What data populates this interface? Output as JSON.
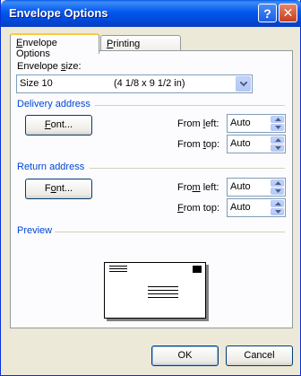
{
  "window": {
    "title": "Envelope Options",
    "help_glyph": "?",
    "close_glyph": "✕"
  },
  "tabs": [
    {
      "label_pre": "",
      "label_key": "E",
      "label_post": "nvelope Options",
      "active": true
    },
    {
      "label_pre": "",
      "label_key": "P",
      "label_post": "rinting Options",
      "active": false
    }
  ],
  "envelope_size": {
    "label_pre": "Envelope ",
    "label_key": "s",
    "label_post": "ize:",
    "value": "Size 10",
    "dimensions": "(4 1/8 x 9 1/2 in)"
  },
  "delivery": {
    "heading": "Delivery address",
    "font_button": {
      "pre": "",
      "key": "F",
      "post": "ont..."
    },
    "from_left": {
      "pre": "From ",
      "key": "l",
      "post": "eft:",
      "value": "Auto"
    },
    "from_top": {
      "pre": "From ",
      "key": "t",
      "post": "op:",
      "value": "Auto"
    }
  },
  "return": {
    "heading": "Return address",
    "font_button": {
      "pre": "F",
      "key": "o",
      "post": "nt..."
    },
    "from_left": {
      "pre": "Fro",
      "key": "m",
      "post": " left:",
      "value": "Auto"
    },
    "from_top": {
      "pre": "",
      "key": "F",
      "post": "rom top:",
      "value": "Auto"
    }
  },
  "preview": {
    "heading": "Preview"
  },
  "footer": {
    "ok_label": "OK",
    "cancel_label": "Cancel"
  },
  "colors": {
    "section_heading": "#0046d5",
    "title_bar": "#0058ee",
    "dialog_bg": "#ece9d8"
  },
  "icons": {
    "help": "question-mark-icon",
    "close": "close-x-icon",
    "dropdown": "chevron-down-icon",
    "spin_up": "spin-up-arrow-icon",
    "spin_down": "spin-down-arrow-icon"
  }
}
